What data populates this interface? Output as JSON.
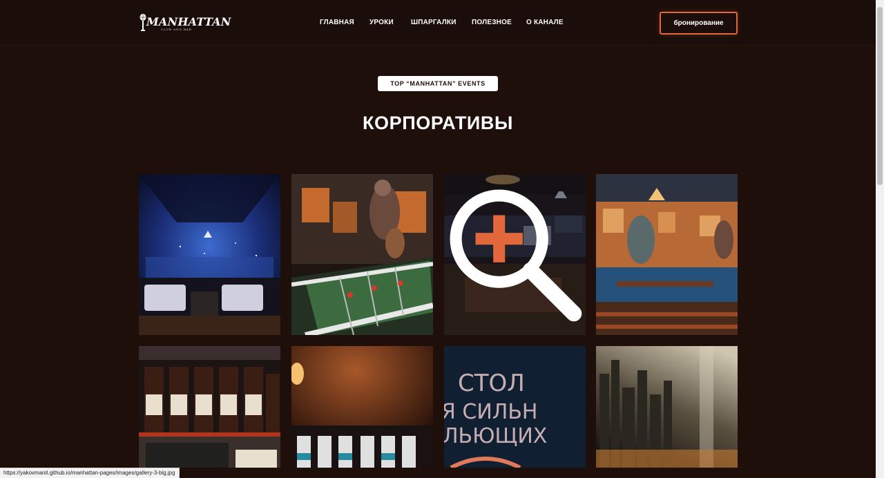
{
  "header": {
    "logo": {
      "wordmark": "MANHATTAN",
      "tagline": "CLUB AND BAR"
    },
    "nav": [
      {
        "label": "ГЛАВНАЯ"
      },
      {
        "label": "УРОКИ"
      },
      {
        "label": "ШПАРГАЛКИ"
      },
      {
        "label": "ПОЛЕЗНОЕ"
      },
      {
        "label": "О КАНАЛЕ"
      }
    ],
    "book_button": "бронирование"
  },
  "section": {
    "badge": "TOP “MANHATTAN” EVENTS",
    "title": "КОРПОРАТИВЫ"
  },
  "gallery": {
    "items": [
      {
        "alt": "lounge with starry ceiling"
      },
      {
        "alt": "foosball table and mural"
      },
      {
        "alt": "dark bar room",
        "hovered": true
      },
      {
        "alt": "hall with murals and tables"
      },
      {
        "alt": "beer bottles on shelf"
      },
      {
        "alt": "beer bottles on bar"
      },
      {
        "alt": "neon lettering wall"
      },
      {
        "alt": "city mural with spotlight"
      }
    ],
    "tile7_text": [
      "СТОЛ",
      "Я СИЛЬН",
      "ЛЬЮЩИХ"
    ]
  },
  "statusbar": {
    "url": "https://yakovmanit.github.io/manhattan-pages/images/gallery-3-big.jpg"
  },
  "colors": {
    "background": "#1e0f0b",
    "accent": "#e2683c",
    "badge_bg": "#ffffff"
  },
  "icons": {
    "logo": "microphone-icon",
    "overlay": "zoom-in-icon"
  }
}
